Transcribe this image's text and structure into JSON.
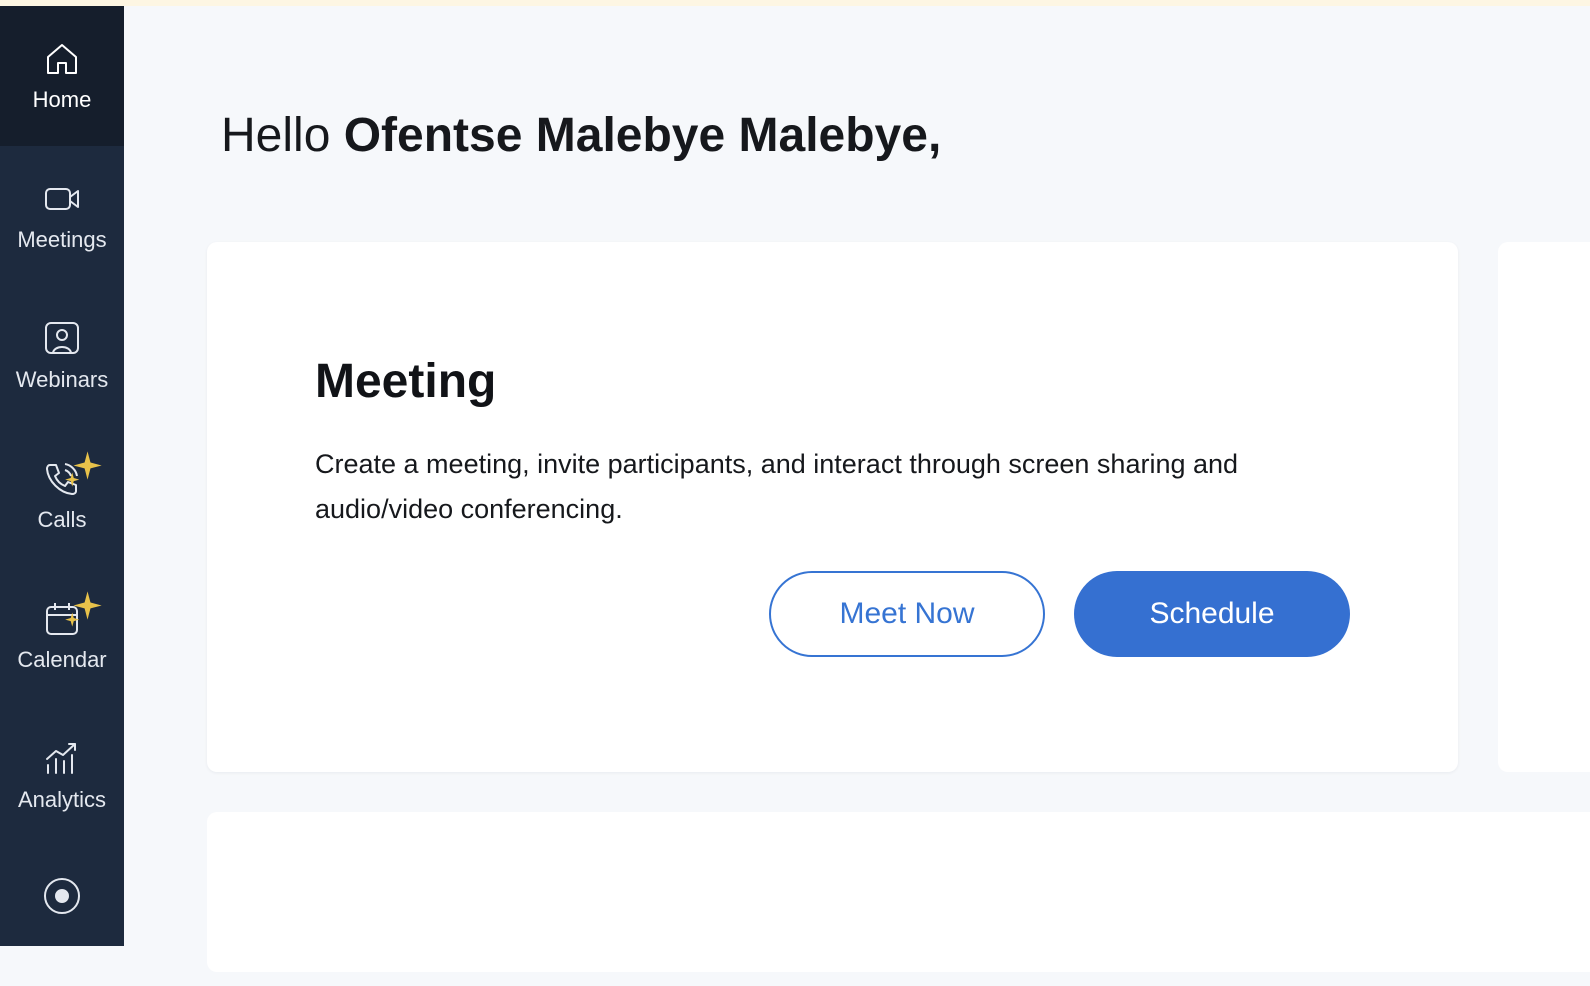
{
  "sidebar": {
    "items": [
      {
        "label": "Home",
        "icon": "home-icon",
        "active": true
      },
      {
        "label": "Meetings",
        "icon": "video-camera-icon"
      },
      {
        "label": "Webinars",
        "icon": "webinar-icon"
      },
      {
        "label": "Calls",
        "icon": "phone-icon",
        "sparkle": true
      },
      {
        "label": "Calendar",
        "icon": "calendar-icon",
        "sparkle": true
      },
      {
        "label": "Analytics",
        "icon": "analytics-icon"
      },
      {
        "label": "",
        "icon": "record-icon"
      }
    ]
  },
  "greeting": {
    "prefix": "Hello ",
    "name": "Ofentse Malebye Malebye,"
  },
  "meeting_card": {
    "title": "Meeting",
    "description": "Create a meeting, invite participants, and interact through screen sharing and audio/video conferencing.",
    "meet_now_label": "Meet Now",
    "schedule_label": "Schedule"
  },
  "colors": {
    "sidebar_bg": "#1d2a3e",
    "accent": "#3570d1",
    "sparkle": "#e8c24a"
  }
}
